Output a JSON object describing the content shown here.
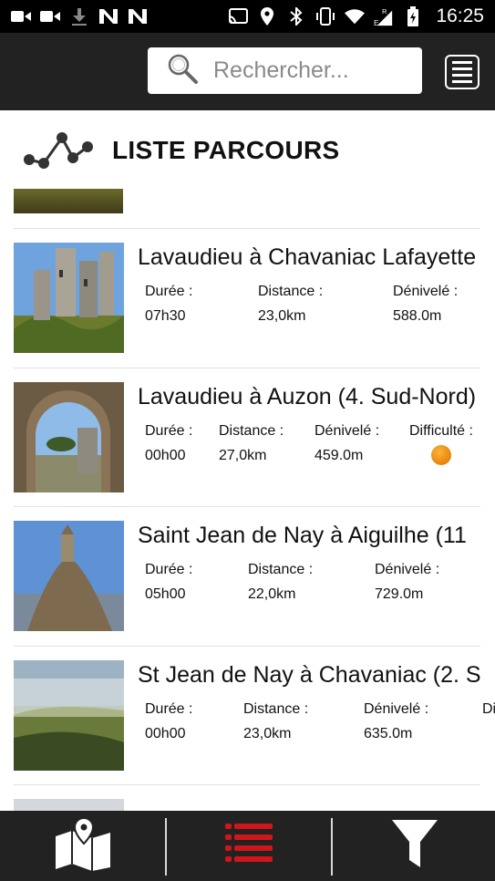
{
  "status_bar": {
    "time": "16:25",
    "icons": [
      "video-icon",
      "video-icon",
      "download-icon",
      "n-icon",
      "n-icon",
      "cast-icon",
      "location-icon",
      "bluetooth-icon",
      "vibrate-icon",
      "wifi-icon",
      "signal-icon",
      "battery-icon"
    ]
  },
  "header": {
    "search_placeholder": "Rechercher...",
    "menu_icon": "menu-list-icon"
  },
  "page": {
    "title": "LISTE PARCOURS",
    "title_icon": "route-icon"
  },
  "routes": [
    {
      "title": "Lavaudieu à Chavaniac Lafayette",
      "stats": [
        {
          "label": "Durée :",
          "value": "07h30"
        },
        {
          "label": "Distance :",
          "value": "23,0km"
        },
        {
          "label": "Dénivelé :",
          "value": "588.0m"
        }
      ],
      "difficulty": null
    },
    {
      "title": "Lavaudieu à Auzon (4. Sud-Nord)",
      "stats": [
        {
          "label": "Durée :",
          "value": "00h00"
        },
        {
          "label": "Distance :",
          "value": "27,0km"
        },
        {
          "label": "Dénivelé :",
          "value": "459.0m"
        }
      ],
      "difficulty": {
        "label": "Difficulté :",
        "color": "#e8900f"
      }
    },
    {
      "title": "Saint Jean de Nay à Aiguilhe (11",
      "stats": [
        {
          "label": "Durée :",
          "value": "05h00"
        },
        {
          "label": "Distance :",
          "value": "22,0km"
        },
        {
          "label": "Dénivelé :",
          "value": "729.0m"
        }
      ],
      "difficulty": null
    },
    {
      "title": "St Jean de Nay à Chavaniac (2. S",
      "stats": [
        {
          "label": "Durée :",
          "value": "00h00"
        },
        {
          "label": "Distance :",
          "value": "23,0km"
        },
        {
          "label": "Dénivelé :",
          "value": "635.0m"
        },
        {
          "label": "Di",
          "value": ""
        }
      ],
      "difficulty": null
    }
  ],
  "bottom_nav": [
    {
      "name": "map-icon",
      "active": false
    },
    {
      "name": "list-icon",
      "active": true
    },
    {
      "name": "filter-icon",
      "active": false
    }
  ],
  "colors": {
    "header_bg": "#222222",
    "active_accent": "#d0161b",
    "difficulty_orange": "#e8900f"
  }
}
